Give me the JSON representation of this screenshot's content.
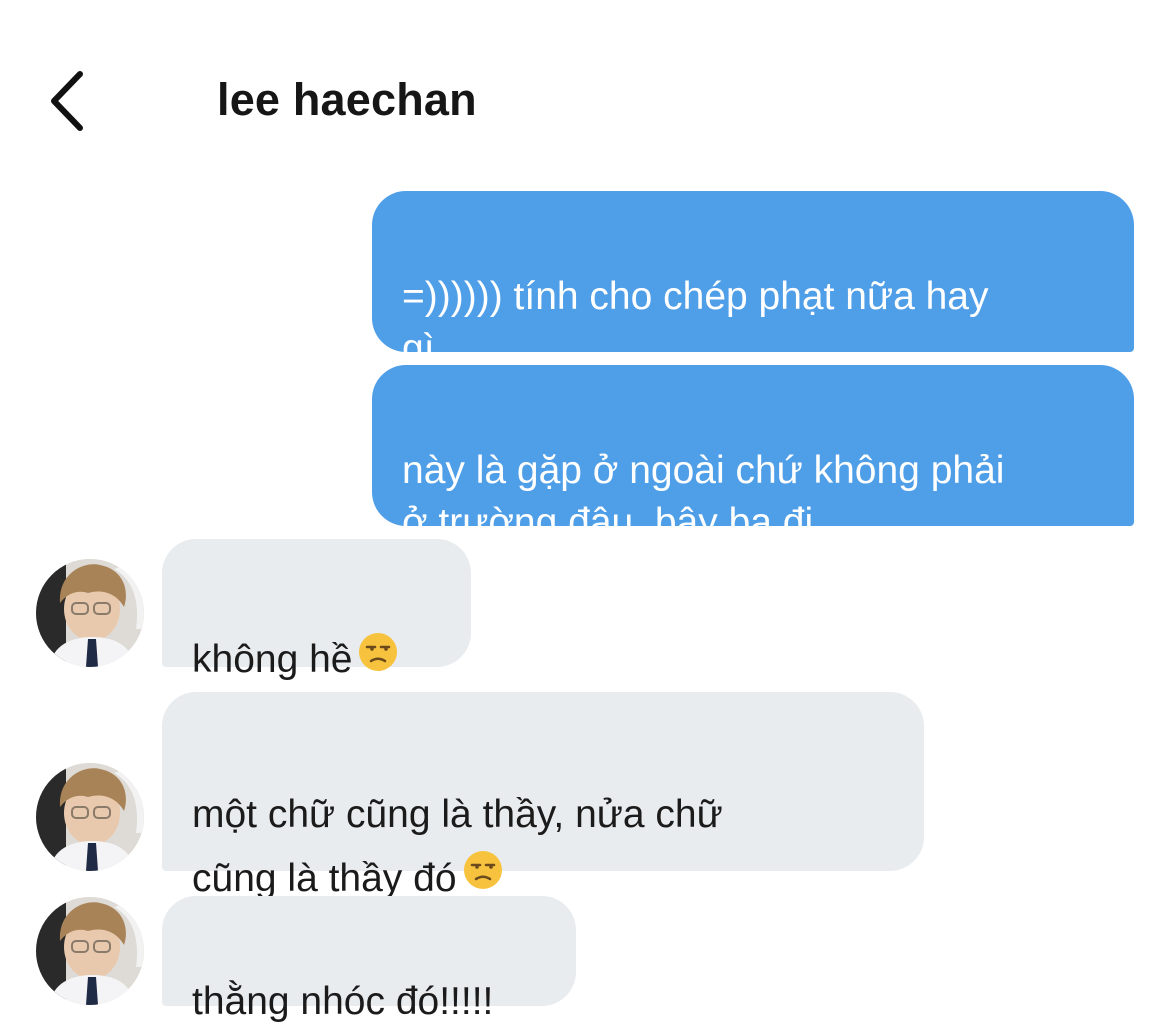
{
  "header": {
    "back_icon": "chevron-left-icon",
    "title": "lee haechan"
  },
  "messages": [
    {
      "direction": "sent",
      "text": "=)))))) tính cho chép phạt nữa hay\ngì"
    },
    {
      "direction": "sent",
      "text": "này là gặp ở ngoài chứ không phải\nở trường đâu, bậy bạ đi"
    },
    {
      "direction": "received",
      "text": "không hề",
      "emoji": "unamused-face-icon"
    },
    {
      "direction": "received",
      "text": "một chữ cũng là thầy, nửa chữ\ncũng là thầy đó",
      "emoji": "unamused-face-icon"
    },
    {
      "direction": "received",
      "text": "thằng nhóc đó!!!!!"
    }
  ],
  "colors": {
    "sent_bubble": "#4f9ee8",
    "received_bubble": "#e9ecef",
    "sent_text": "#ffffff",
    "received_text": "#1b1b1b"
  }
}
